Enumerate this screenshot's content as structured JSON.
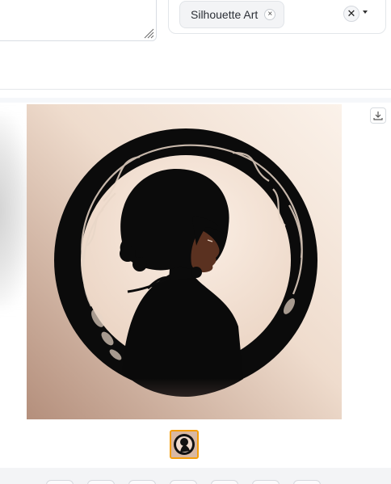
{
  "style_selector": {
    "selected_chip_label": "Silhouette Art",
    "chip_remove_symbol": "×",
    "clear_symbol": "✕"
  },
  "gallery": {
    "image_subject": "silhouette of a girl with short hair inside an ornate black circular frame with vines",
    "download_icon": "download-icon",
    "thumbnail_selected": true
  },
  "colors": {
    "chip_bg": "#f3f4f6",
    "thumbnail_border": "#f59e0b",
    "image_bg_light": "#f3e6da",
    "image_bg_dark": "#b89480"
  }
}
